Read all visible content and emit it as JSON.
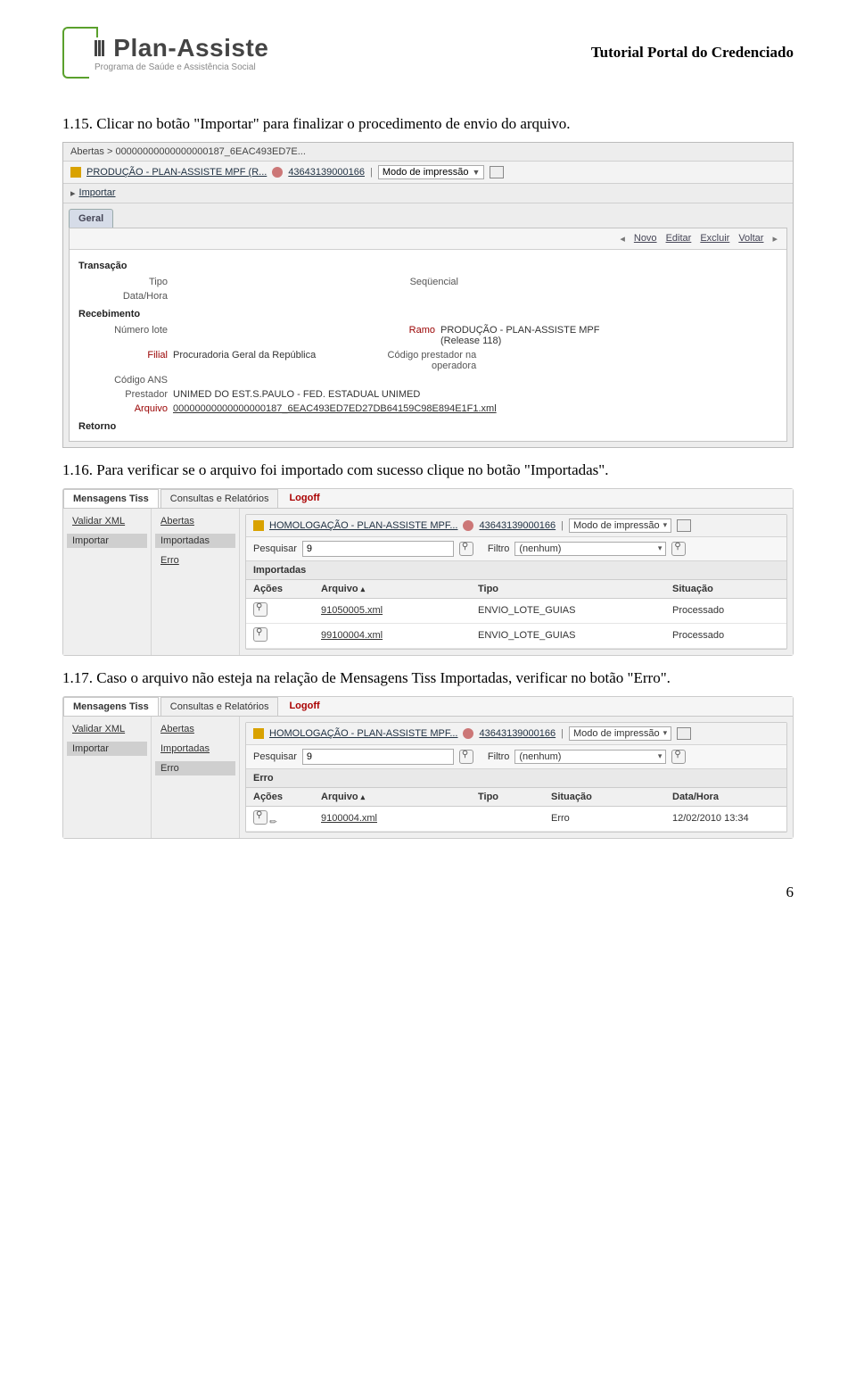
{
  "header": {
    "right": "Tutorial Portal do Credenciado"
  },
  "logo": {
    "title": "Plan-Assiste",
    "sub": "Programa de Saúde e Assistência Social"
  },
  "p1": "1.15. Clicar no botão \"Importar\" para finalizar o procedimento de envio do arquivo.",
  "p2": "1.16. Para verificar se o arquivo foi importado com sucesso clique no botão \"Importadas\".",
  "p3": "1.17. Caso o arquivo não esteja na relação de Mensagens Tiss Importadas, verificar no botão \"Erro\".",
  "page_num": "6",
  "shotA": {
    "crumb": "Abertas > 00000000000000000187_6EAC493ED7E...",
    "producao": "PRODUÇÃO - PLAN-ASSISTE MPF (R...",
    "numero": "43643139000166",
    "modo": "Modo de impressão",
    "importar": "Importar",
    "geral": "Geral",
    "actions": {
      "novo": "Novo",
      "editar": "Editar",
      "excluir": "Excluir",
      "voltar": "Voltar"
    },
    "sec_trans": "Transação",
    "f_tipo": "Tipo",
    "f_seq": "Seqüencial",
    "f_datahora": "Data/Hora",
    "sec_receb": "Recebimento",
    "f_numlote": "Número lote",
    "f_ramo": "Ramo",
    "v_ramo": "PRODUÇÃO - PLAN-ASSISTE MPF (Release 118)",
    "f_filial": "Filial",
    "v_filial": "Procuradoria Geral da República",
    "f_codop": "Código prestador na operadora",
    "f_codans": "Código ANS",
    "f_prestador": "Prestador",
    "v_prestador": "UNIMED DO EST.S.PAULO - FED. ESTADUAL UNIMED",
    "f_arquivo": "Arquivo",
    "v_arquivo": "00000000000000000187_6EAC493ED7ED27DB64159C98E894E1F1.xml",
    "sec_retorno": "Retorno"
  },
  "tabs": {
    "mensagens": "Mensagens Tiss",
    "consultas": "Consultas e Relatórios",
    "logoff": "Logoff"
  },
  "side1": {
    "validar": "Validar XML",
    "importar": "Importar"
  },
  "side2": {
    "abertas": "Abertas",
    "importadas": "Importadas",
    "erro": "Erro"
  },
  "panel": {
    "homolog": "HOMOLOGAÇÃO - PLAN-ASSISTE MPF...",
    "numero": "43643139000166",
    "modo": "Modo de impressão",
    "pesq_lbl": "Pesquisar",
    "pesq_val": "9",
    "filtro_lbl": "Filtro",
    "filtro_val": "(nenhum)"
  },
  "grid_imp": {
    "title": "Importadas",
    "cols": {
      "acoes": "Ações",
      "arquivo": "Arquivo",
      "tipo": "Tipo",
      "situacao": "Situação"
    },
    "rows": [
      {
        "arquivo": "91050005.xml",
        "tipo": "ENVIO_LOTE_GUIAS",
        "situ": "Processado"
      },
      {
        "arquivo": "99100004.xml",
        "tipo": "ENVIO_LOTE_GUIAS",
        "situ": "Processado"
      }
    ]
  },
  "grid_err": {
    "title": "Erro",
    "cols": {
      "acoes": "Ações",
      "arquivo": "Arquivo",
      "tipo": "Tipo",
      "situacao": "Situação",
      "datahora": "Data/Hora"
    },
    "rows": [
      {
        "arquivo": "9100004.xml",
        "tipo": "",
        "situ": "Erro",
        "dh": "12/02/2010 13:34"
      }
    ]
  }
}
